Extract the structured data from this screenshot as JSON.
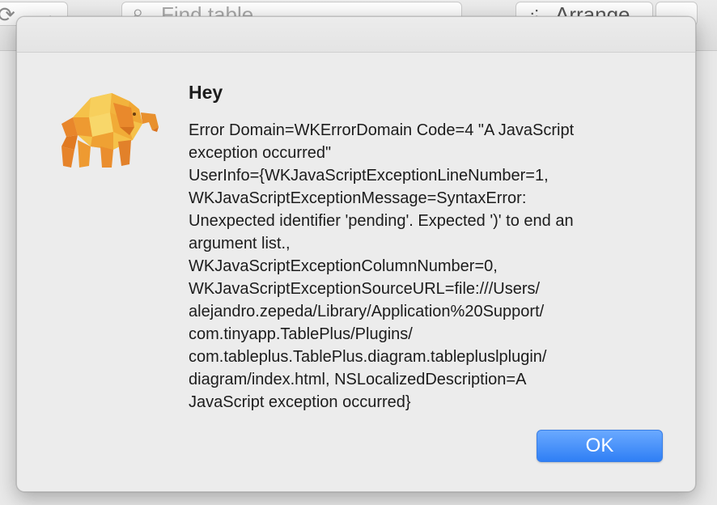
{
  "toolbar": {
    "search_placeholder": "Find table",
    "arrange_label": "Arrange"
  },
  "alert": {
    "title": "Hey",
    "message_lines": [
      "Error Domain=WKErrorDomain Code=4 \"A JavaScript",
      "exception occurred\"",
      "UserInfo={WKJavaScriptExceptionLineNumber=1,",
      "WKJavaScriptExceptionMessage=SyntaxError:",
      "Unexpected identifier 'pending'. Expected ')' to end an",
      "argument list.,",
      "WKJavaScriptExceptionColumnNumber=0,",
      "WKJavaScriptExceptionSourceURL=file:///Users/",
      "alejandro.zepeda/Library/Application%20Support/",
      "com.tinyapp.TablePlus/Plugins/",
      "com.tableplus.TablePlus.diagram.tablepluslplugin/",
      "diagram/index.html, NSLocalizedDescription=A",
      "JavaScript exception occurred}"
    ],
    "ok_label": "OK",
    "icon": "tableplus-elephant-icon"
  },
  "colors": {
    "ok_button": "#3584f6",
    "sheet_background": "#ececec"
  }
}
